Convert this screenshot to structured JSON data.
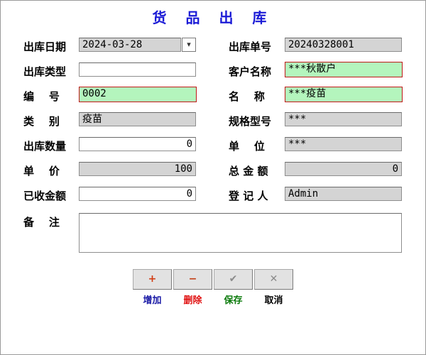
{
  "title": "货 品 出 库",
  "labels": {
    "out_date": "出库日期",
    "out_no": "出库单号",
    "out_type": "出库类型",
    "customer": "客户名称",
    "code": "编    号",
    "name": "名    称",
    "category": "类    别",
    "spec": "规格型号",
    "qty": "出库数量",
    "unit": "单    位",
    "price": "单    价",
    "total": "总 金 额",
    "received": "已收金额",
    "registrar": "登 记 人",
    "remark": "备    注"
  },
  "values": {
    "out_date": "2024-03-28",
    "out_no": "20240328001",
    "out_type": "",
    "customer": "***秋散户",
    "code": "0002",
    "name": "***疫苗",
    "category": "疫苗",
    "spec": "***",
    "qty": "0",
    "unit": "***",
    "price": "100",
    "total": "0",
    "received": "0",
    "registrar": "Admin",
    "remark": ""
  },
  "buttons": {
    "add": {
      "label": "增加",
      "color": "#1a1aa6",
      "icon": "plus-icon",
      "glyph": "+"
    },
    "delete": {
      "label": "删除",
      "color": "#e01010",
      "icon": "minus-icon",
      "glyph": "−"
    },
    "save": {
      "label": "保存",
      "color": "#0a7a0a",
      "icon": "check-icon",
      "glyph": "✔"
    },
    "cancel": {
      "label": "取消",
      "color": "#000000",
      "icon": "cross-icon",
      "glyph": "✕"
    }
  },
  "colors": {
    "title": "#1a1ad6",
    "highlight_field": "#b4f5bd",
    "readonly_field": "#d4d4d4"
  }
}
